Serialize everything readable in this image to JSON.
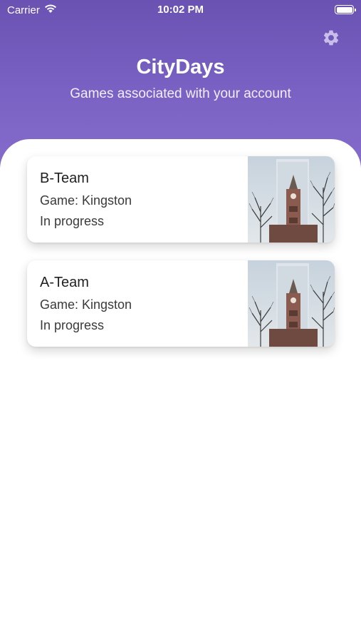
{
  "status_bar": {
    "carrier": "Carrier",
    "time": "10:02 PM"
  },
  "header": {
    "title": "CityDays",
    "subtitle": "Games associated with your account"
  },
  "games": [
    {
      "team": "B-Team",
      "game": "Game: Kingston",
      "status": "In progress"
    },
    {
      "team": "A-Team",
      "game": "Game: Kingston",
      "status": "In progress"
    }
  ],
  "colors": {
    "header_top": "#6a52b3",
    "header_bottom": "#856ccb",
    "background": "#ffffff",
    "card": "#ffffff"
  },
  "icons": {
    "settings": "gear-icon",
    "wifi": "wifi-icon",
    "battery": "battery-icon"
  }
}
